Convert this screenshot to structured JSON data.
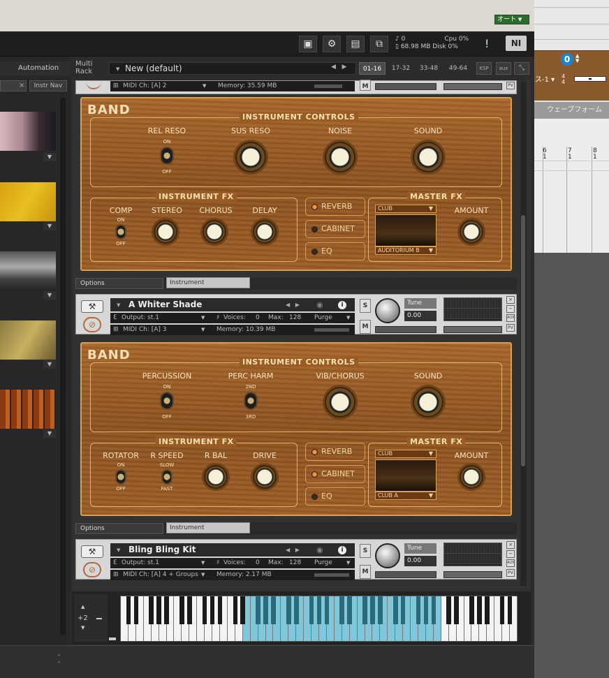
{
  "host": {
    "auto_label": "オート",
    "tempo": "0",
    "mode_label": "ス-1",
    "time_sig_top": "4",
    "time_sig_bottom": "4",
    "waveform_label": "ウェーブフォーム",
    "ruler_marks": [
      "6\n1",
      "7\n1",
      "8\n1"
    ]
  },
  "kontakt": {
    "cpu": "0%",
    "disk": "0%",
    "voices": "0",
    "memory": "68.98 MB",
    "cpu_label": "Cpu",
    "disk_label": "Disk",
    "ni_logo": "NI",
    "browser": {
      "automation_label": "Automation",
      "instr_nav": "Instr Nav",
      "clear": "×"
    },
    "rack": {
      "label": "Multi Rack",
      "preset": "New (default)",
      "pages": [
        "01-16",
        "17-32",
        "33-48",
        "49-64"
      ],
      "ksp": "KSP",
      "aux": "aux"
    },
    "instruments": [
      {
        "midi_ch": "MIDI Ch: [A] 2",
        "memory": "Memory: 35.59 MB"
      },
      {
        "name": "A Whiter Shade",
        "output": "Output: st.1",
        "voices_label": "Voices:",
        "voices": "0",
        "max_label": "Max:",
        "max": "128",
        "purge": "Purge",
        "midi_ch": "MIDI Ch: [A] 3",
        "memory": "Memory: 10.39 MB",
        "tune_label": "Tune",
        "tune": "0.00"
      },
      {
        "name": "Bling Bling Kit",
        "output": "Output: st.1",
        "voices_label": "Voices:",
        "voices": "0",
        "max_label": "Max:",
        "max": "128",
        "purge": "Purge",
        "midi_ch": "MIDI Ch: [A] 4 + Groups",
        "memory": "Memory: 2.17 MB",
        "tune_label": "Tune",
        "tune": "0.00"
      }
    ],
    "panel1": {
      "band": "BAND",
      "controls_title": "INSTRUMENT CONTROLS",
      "controls": [
        "REL RESO",
        "SUS RESO",
        "NOISE",
        "SOUND"
      ],
      "fx_title": "INSTRUMENT FX",
      "fx": [
        "COMP",
        "STEREO",
        "CHORUS",
        "DELAY"
      ],
      "on": "ON",
      "off": "OFF",
      "reverb": "REVERB",
      "cabinet": "CABINET",
      "eq": "EQ",
      "master_title": "MASTER FX",
      "club": "CLUB",
      "room": "AUDITORIUM B",
      "amount": "AMOUNT"
    },
    "panel2": {
      "band": "BAND",
      "controls_title": "INSTRUMENT CONTROLS",
      "controls": [
        "PERCUSSION",
        "PERC HARM",
        "VIB/CHORUS",
        "SOUND"
      ],
      "fx_title": "INSTRUMENT FX",
      "fx": [
        "ROTATOR",
        "R SPEED",
        "R BAL",
        "DRIVE"
      ],
      "on": "ON",
      "off": "OFF",
      "second": "2ND",
      "third": "3RD",
      "slow": "SLOW",
      "fast": "FAST",
      "reverb": "REVERB",
      "cabinet": "CABINET",
      "eq": "EQ",
      "master_title": "MASTER FX",
      "club": "CLUB",
      "room": "CLUB A",
      "amount": "AMOUNT"
    },
    "options_label": "Options",
    "instrument_tab": "Instrument",
    "keyboard": {
      "octave": "+2"
    }
  },
  "colors": {
    "wood": "#9a5b24",
    "trim": "#d6a055",
    "key_highlight": "#7fc8dc"
  }
}
